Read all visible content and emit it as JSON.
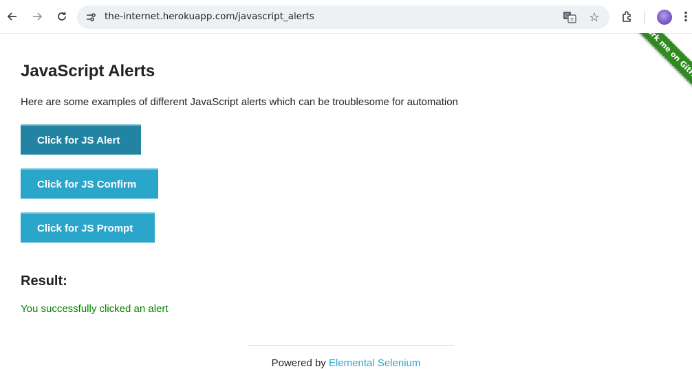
{
  "browser": {
    "url": "the-internet.herokuapp.com/javascript_alerts",
    "icons": [
      "back-icon",
      "forward-icon",
      "reload-icon",
      "site-info-icon",
      "translate-icon",
      "bookmark-star-icon",
      "extensions-icon",
      "profile-avatar",
      "kebab-menu-icon"
    ]
  },
  "ribbon": {
    "label": "Fork me on GitHub",
    "color": "#2f8a1f"
  },
  "page": {
    "title": "JavaScript Alerts",
    "intro": "Here are some examples of different JavaScript alerts which can be troublesome for automation",
    "buttons": {
      "alert": "Click for JS Alert",
      "confirm": "Click for JS Confirm",
      "prompt": "Click for JS Prompt"
    },
    "result_heading": "Result:",
    "result_text": "You successfully clicked an alert",
    "result_color": "#008000"
  },
  "footer": {
    "prefix": "Powered by",
    "link_text": "Elemental Selenium",
    "link_color": "#2ba6cb"
  },
  "colors": {
    "button_active": "#2283a3",
    "button": "#2ba6cb"
  }
}
